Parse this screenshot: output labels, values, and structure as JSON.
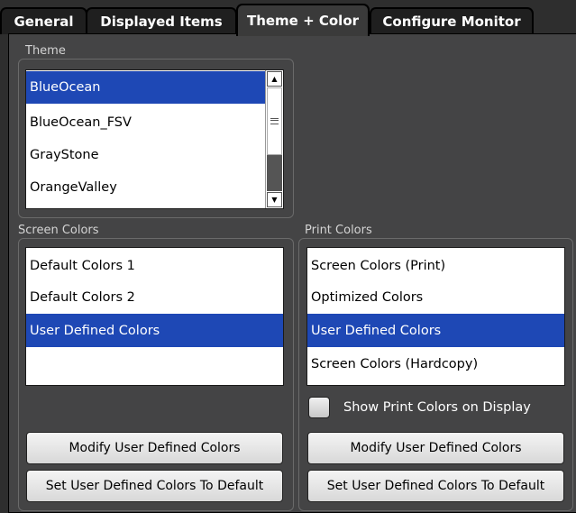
{
  "tabs": [
    {
      "label": "General"
    },
    {
      "label": "Displayed Items"
    },
    {
      "label": "Theme + Color"
    },
    {
      "label": "Configure Monitor"
    }
  ],
  "active_tab": "Theme + Color",
  "theme": {
    "label": "Theme",
    "items": [
      "BlueOcean",
      "BlueOcean_FSV",
      "GrayStone",
      "OrangeValley"
    ],
    "selected": "BlueOcean"
  },
  "screen_colors": {
    "label": "Screen Colors",
    "items": [
      "Default Colors 1",
      "Default Colors 2",
      "User Defined Colors"
    ],
    "selected": "User Defined Colors",
    "modify_button": "Modify User Defined Colors",
    "default_button": "Set User Defined Colors To Default"
  },
  "print_colors": {
    "label": "Print Colors",
    "items": [
      "Screen Colors (Print)",
      "Optimized Colors",
      "User Defined Colors",
      "Screen Colors (Hardcopy)"
    ],
    "selected": "User Defined Colors",
    "show_checkbox_label": "Show Print Colors on Display",
    "show_checkbox_checked": false,
    "modify_button": "Modify User Defined Colors",
    "default_button": "Set User Defined Colors To Default"
  },
  "colors": {
    "selection": "#1e48b5",
    "background": "#444445"
  }
}
